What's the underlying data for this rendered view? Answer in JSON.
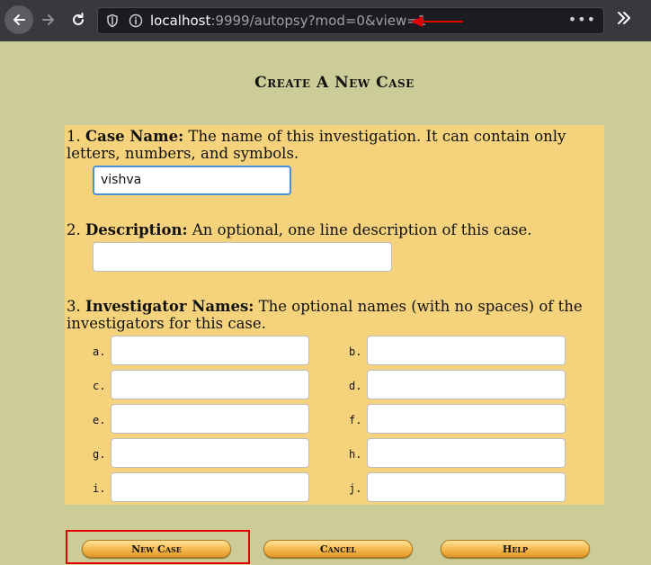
{
  "browser": {
    "url_host": "localhost",
    "url_rest": ":9999/autopsy?mod=0&view=1",
    "menu_dots": "•••"
  },
  "page": {
    "title": "Create A New Case"
  },
  "case_name": {
    "number": "1.",
    "label": "Case Name:",
    "description": " The name of this investigation. It can contain only letters, numbers, and symbols.",
    "value": "vishva"
  },
  "description": {
    "number": "2.",
    "label": "Description:",
    "description": " An optional, one line description of this case.",
    "value": ""
  },
  "investigators": {
    "number": "3.",
    "label": "Investigator Names:",
    "description": " The optional names (with no spaces) of the investigators for this case.",
    "letters": [
      "a.",
      "b.",
      "c.",
      "d.",
      "e.",
      "f.",
      "g.",
      "h.",
      "i.",
      "j."
    ]
  },
  "buttons": {
    "new_case": "New Case",
    "cancel": "Cancel",
    "help": "Help"
  },
  "colors": {
    "page_bg": "#cccc99",
    "panel_bg": "#f5d37d",
    "annotation_red": "#e00000"
  }
}
